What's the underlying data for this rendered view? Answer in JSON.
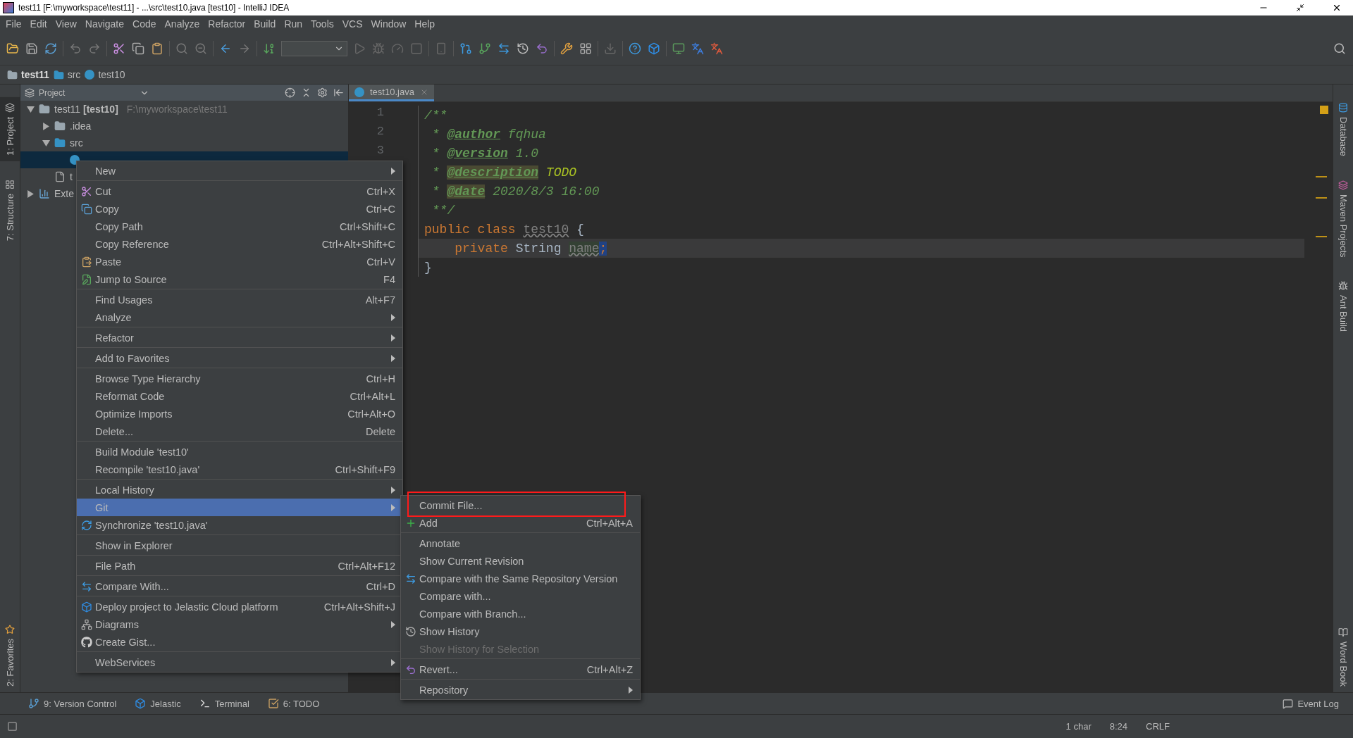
{
  "window": {
    "title": "test11 [F:\\myworkspace\\test11] - ...\\src\\test10.java [test10] - IntelliJ IDEA"
  },
  "menu_bar": [
    "File",
    "Edit",
    "View",
    "Navigate",
    "Code",
    "Analyze",
    "Refactor",
    "Build",
    "Run",
    "Tools",
    "VCS",
    "Window",
    "Help"
  ],
  "breadcrumbs": [
    "test11",
    "src",
    "test10"
  ],
  "left_tool_strip": [
    {
      "label": "1: Project",
      "selected": true
    },
    {
      "label": "7: Structure",
      "selected": false
    },
    {
      "label": "2: Favorites",
      "selected": false
    }
  ],
  "project_panel": {
    "title": "Project",
    "tree": [
      {
        "label": "test11 **[test10]**",
        "path": "F:\\myworkspace\\test11",
        "expanded": true,
        "selected": false,
        "children": [
          {
            "label": ".idea",
            "expanded": false,
            "selected": false
          },
          {
            "label": "src",
            "expanded": true,
            "selected": false,
            "children": [
              {
                "selected": true
              }
            ]
          },
          {
            "label": "t",
            "selected": false
          }
        ]
      },
      {
        "label": "Exte",
        "expanded": false,
        "selected": false
      }
    ]
  },
  "editor": {
    "tabs": [
      {
        "label": "test10.java",
        "selected": true
      }
    ],
    "lines": [
      {
        "number": "1",
        "current": false,
        "tokens": [
          {
            "text": "/**",
            "kind": "comment"
          }
        ]
      },
      {
        "number": "2",
        "current": false,
        "tokens": [
          {
            "text": " * ",
            "kind": "comment"
          },
          {
            "text": "@author",
            "kind": "tag"
          },
          {
            "text": " fqhua",
            "kind": "comment"
          }
        ]
      },
      {
        "number": "3",
        "current": false,
        "tokens": [
          {
            "text": " * ",
            "kind": "comment"
          },
          {
            "text": "@version",
            "kind": "tag"
          },
          {
            "text": " 1.0",
            "kind": "comment"
          }
        ]
      },
      {
        "current": false,
        "tokens": [
          {
            "text": " * ",
            "kind": "comment"
          },
          {
            "text": "@description",
            "kind": "tagmark"
          },
          {
            "text": " TODO",
            "kind": "todo"
          }
        ]
      },
      {
        "current": false,
        "tokens": [
          {
            "text": " * ",
            "kind": "comment"
          },
          {
            "text": "@date",
            "kind": "tagmark"
          },
          {
            "text": " 2020/8/3 16:00",
            "kind": "comment"
          }
        ]
      },
      {
        "current": false,
        "tokens": [
          {
            "text": " **/",
            "kind": "comment"
          }
        ]
      },
      {
        "current": false,
        "tokens": [
          {
            "text": "public class ",
            "kind": "keyword"
          },
          {
            "text": "test10",
            "kind": "unused"
          },
          {
            "text": " {",
            "kind": "plain"
          }
        ]
      },
      {
        "current": true,
        "tokens": [
          {
            "text": "    private ",
            "kind": "keyword"
          },
          {
            "text": "String ",
            "kind": "plain"
          },
          {
            "text": "name",
            "kind": "unusedmark"
          },
          {
            "text": ";",
            "kind": "caret"
          }
        ]
      },
      {
        "current": false,
        "tokens": [
          {
            "text": "}",
            "kind": "plain"
          }
        ]
      }
    ]
  },
  "right_tool_strip": [
    "Database",
    "Maven Projects",
    "Ant Build",
    "Word Book"
  ],
  "context_menu": {
    "groups": [
      [
        {
          "label": "New",
          "submenu": true,
          "selected": false
        }
      ],
      [
        {
          "label": "Cut",
          "shortcut": "Ctrl+X",
          "submenu": false,
          "selected": false
        },
        {
          "label": "Copy",
          "shortcut": "Ctrl+C",
          "submenu": false,
          "selected": false
        },
        {
          "label": "Copy Path",
          "shortcut": "Ctrl+Shift+C",
          "submenu": false,
          "selected": false
        },
        {
          "label": "Copy Reference",
          "shortcut": "Ctrl+Alt+Shift+C",
          "submenu": false,
          "selected": false
        },
        {
          "label": "Paste",
          "shortcut": "Ctrl+V",
          "submenu": false,
          "selected": false
        },
        {
          "label": "Jump to Source",
          "shortcut": "F4",
          "submenu": false,
          "selected": false
        }
      ],
      [
        {
          "label": "Find Usages",
          "shortcut": "Alt+F7",
          "submenu": false,
          "selected": false
        },
        {
          "label": "Analyze",
          "submenu": true,
          "selected": false
        }
      ],
      [
        {
          "label": "Refactor",
          "submenu": true,
          "selected": false
        }
      ],
      [
        {
          "label": "Add to Favorites",
          "submenu": true,
          "selected": false
        }
      ],
      [
        {
          "label": "Browse Type Hierarchy",
          "shortcut": "Ctrl+H",
          "submenu": false,
          "selected": false
        },
        {
          "label": "Reformat Code",
          "shortcut": "Ctrl+Alt+L",
          "submenu": false,
          "selected": false
        },
        {
          "label": "Optimize Imports",
          "shortcut": "Ctrl+Alt+O",
          "submenu": false,
          "selected": false
        },
        {
          "label": "Delete...",
          "shortcut": "Delete",
          "submenu": false,
          "selected": false
        }
      ],
      [
        {
          "label": "Build Module 'test10'",
          "submenu": false,
          "selected": false
        },
        {
          "label": "Recompile 'test10.java'",
          "shortcut": "Ctrl+Shift+F9",
          "submenu": false,
          "selected": false
        }
      ],
      [
        {
          "label": "Local History",
          "submenu": true,
          "selected": false
        },
        {
          "label": "Git",
          "submenu": true,
          "selected": true
        },
        {
          "label": "Synchronize 'test10.java'",
          "submenu": false,
          "selected": false
        }
      ],
      [
        {
          "label": "Show in Explorer",
          "submenu": false,
          "selected": false
        }
      ],
      [
        {
          "label": "File Path",
          "shortcut": "Ctrl+Alt+F12",
          "submenu": false,
          "selected": false
        }
      ],
      [
        {
          "label": "Compare With...",
          "shortcut": "Ctrl+D",
          "submenu": false,
          "selected": false
        }
      ],
      [
        {
          "label": "Deploy project to Jelastic Cloud platform",
          "shortcut": "Ctrl+Alt+Shift+J",
          "submenu": false,
          "selected": false
        },
        {
          "label": "Diagrams",
          "submenu": true,
          "selected": false
        },
        {
          "label": "Create Gist...",
          "submenu": false,
          "selected": false
        }
      ],
      [
        {
          "label": "WebServices",
          "submenu": true,
          "selected": false
        }
      ]
    ]
  },
  "git_submenu": {
    "groups": [
      [
        {
          "label": "Commit File...",
          "submenu": false,
          "disabled": false,
          "highlighted": true
        },
        {
          "label": "Add",
          "shortcut": "Ctrl+Alt+A",
          "submenu": false,
          "disabled": false,
          "highlighted": false
        }
      ],
      [
        {
          "label": "Annotate",
          "submenu": false,
          "disabled": false,
          "highlighted": false
        },
        {
          "label": "Show Current Revision",
          "submenu": false,
          "disabled": false,
          "highlighted": false
        },
        {
          "label": "Compare with the Same Repository Version",
          "submenu": false,
          "disabled": false,
          "highlighted": false
        },
        {
          "label": "Compare with...",
          "submenu": false,
          "disabled": false,
          "highlighted": false
        },
        {
          "label": "Compare with Branch...",
          "submenu": false,
          "disabled": false,
          "highlighted": false
        },
        {
          "label": "Show History",
          "submenu": false,
          "disabled": false,
          "highlighted": false
        },
        {
          "label": "Show History for Selection",
          "submenu": false,
          "disabled": true,
          "highlighted": false
        }
      ],
      [
        {
          "label": "Revert...",
          "shortcut": "Ctrl+Alt+Z",
          "submenu": false,
          "disabled": false,
          "highlighted": false
        }
      ],
      [
        {
          "label": "Repository",
          "submenu": true,
          "disabled": false,
          "highlighted": false
        }
      ]
    ]
  },
  "tool_window_bar": [
    "9: Version Control",
    "Jelastic",
    "Terminal",
    "6: TODO"
  ],
  "event_log": "Event Log",
  "status_bar": [
    "1 char",
    "8:24",
    "CRLF"
  ]
}
